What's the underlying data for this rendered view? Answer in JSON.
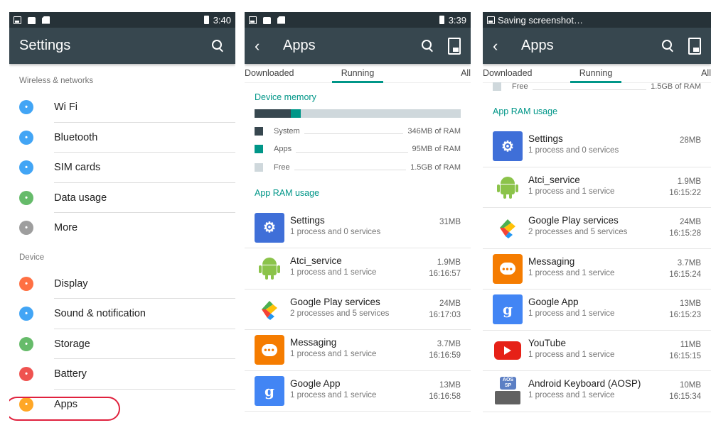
{
  "screen1": {
    "status": {
      "time": "3:40"
    },
    "title": "Settings",
    "section_wireless": "Wireless & networks",
    "wireless_items": [
      {
        "label": "Wi Fi",
        "icon": "wifi-icon",
        "color": "#42a5f5"
      },
      {
        "label": "Bluetooth",
        "icon": "bluetooth-icon",
        "color": "#42a5f5"
      },
      {
        "label": "SIM cards",
        "icon": "sim-card-icon",
        "color": "#42a5f5"
      },
      {
        "label": "Data usage",
        "icon": "data-usage-icon",
        "color": "#66bb6a"
      },
      {
        "label": "More",
        "icon": "more-icon",
        "color": "#9e9e9e"
      }
    ],
    "section_device": "Device",
    "device_items": [
      {
        "label": "Display",
        "icon": "display-icon",
        "color": "#ff7043"
      },
      {
        "label": "Sound & notification",
        "icon": "sound-icon",
        "color": "#42a5f5"
      },
      {
        "label": "Storage",
        "icon": "storage-icon",
        "color": "#66bb6a"
      },
      {
        "label": "Battery",
        "icon": "battery-icon",
        "color": "#ef5350"
      },
      {
        "label": "Apps",
        "icon": "apps-icon",
        "color": "#ffa726"
      }
    ],
    "highlight_color": "#e0213d"
  },
  "screen2": {
    "status": {
      "time": "3:39"
    },
    "title": "Apps",
    "tabs": [
      "Downloaded",
      "Running",
      "All"
    ],
    "device_memory": "Device memory",
    "memory": [
      {
        "label": "System",
        "value": "346MB of RAM",
        "color": "#37474f"
      },
      {
        "label": "Apps",
        "value": "95MB of RAM",
        "color": "#009688"
      },
      {
        "label": "Free",
        "value": "1.5GB of RAM",
        "color": "#cfd8dc"
      }
    ],
    "app_ram_usage": "App RAM usage",
    "apps": [
      {
        "name": "Settings",
        "sub": "1 process and 0 services",
        "size": "31MB",
        "time": ""
      },
      {
        "name": "Atci_service",
        "sub": "1 process and 1 service",
        "size": "1.9MB",
        "time": "16:16:57"
      },
      {
        "name": "Google Play services",
        "sub": "2 processes and 5 services",
        "size": "24MB",
        "time": "16:17:03"
      },
      {
        "name": "Messaging",
        "sub": "1 process and 1 service",
        "size": "3.7MB",
        "time": "16:16:59"
      },
      {
        "name": "Google App",
        "sub": "1 process and 1 service",
        "size": "13MB",
        "time": "16:16:58"
      }
    ]
  },
  "screen3": {
    "status": {
      "note": "Saving screenshot…"
    },
    "title": "Apps",
    "tabs": [
      "Downloaded",
      "Running",
      "All"
    ],
    "memory_free": {
      "label": "Free",
      "value": "1.5GB of RAM"
    },
    "app_ram_usage": "App RAM usage",
    "apps": [
      {
        "name": "Settings",
        "sub": "1 process and 0 services",
        "size": "28MB",
        "time": ""
      },
      {
        "name": "Atci_service",
        "sub": "1 process and 1 service",
        "size": "1.9MB",
        "time": "16:15:22"
      },
      {
        "name": "Google Play services",
        "sub": "2 processes and 5 services",
        "size": "24MB",
        "time": "16:15:28"
      },
      {
        "name": "Messaging",
        "sub": "1 process and 1 service",
        "size": "3.7MB",
        "time": "16:15:24"
      },
      {
        "name": "Google App",
        "sub": "1 process and 1 service",
        "size": "13MB",
        "time": "16:15:23"
      },
      {
        "name": "YouTube",
        "sub": "1 process and 1 service",
        "size": "11MB",
        "time": "16:15:15"
      },
      {
        "name": "Android Keyboard (AOSP)",
        "sub": "1 process and 1 service",
        "size": "10MB",
        "time": "16:15:34"
      }
    ]
  }
}
